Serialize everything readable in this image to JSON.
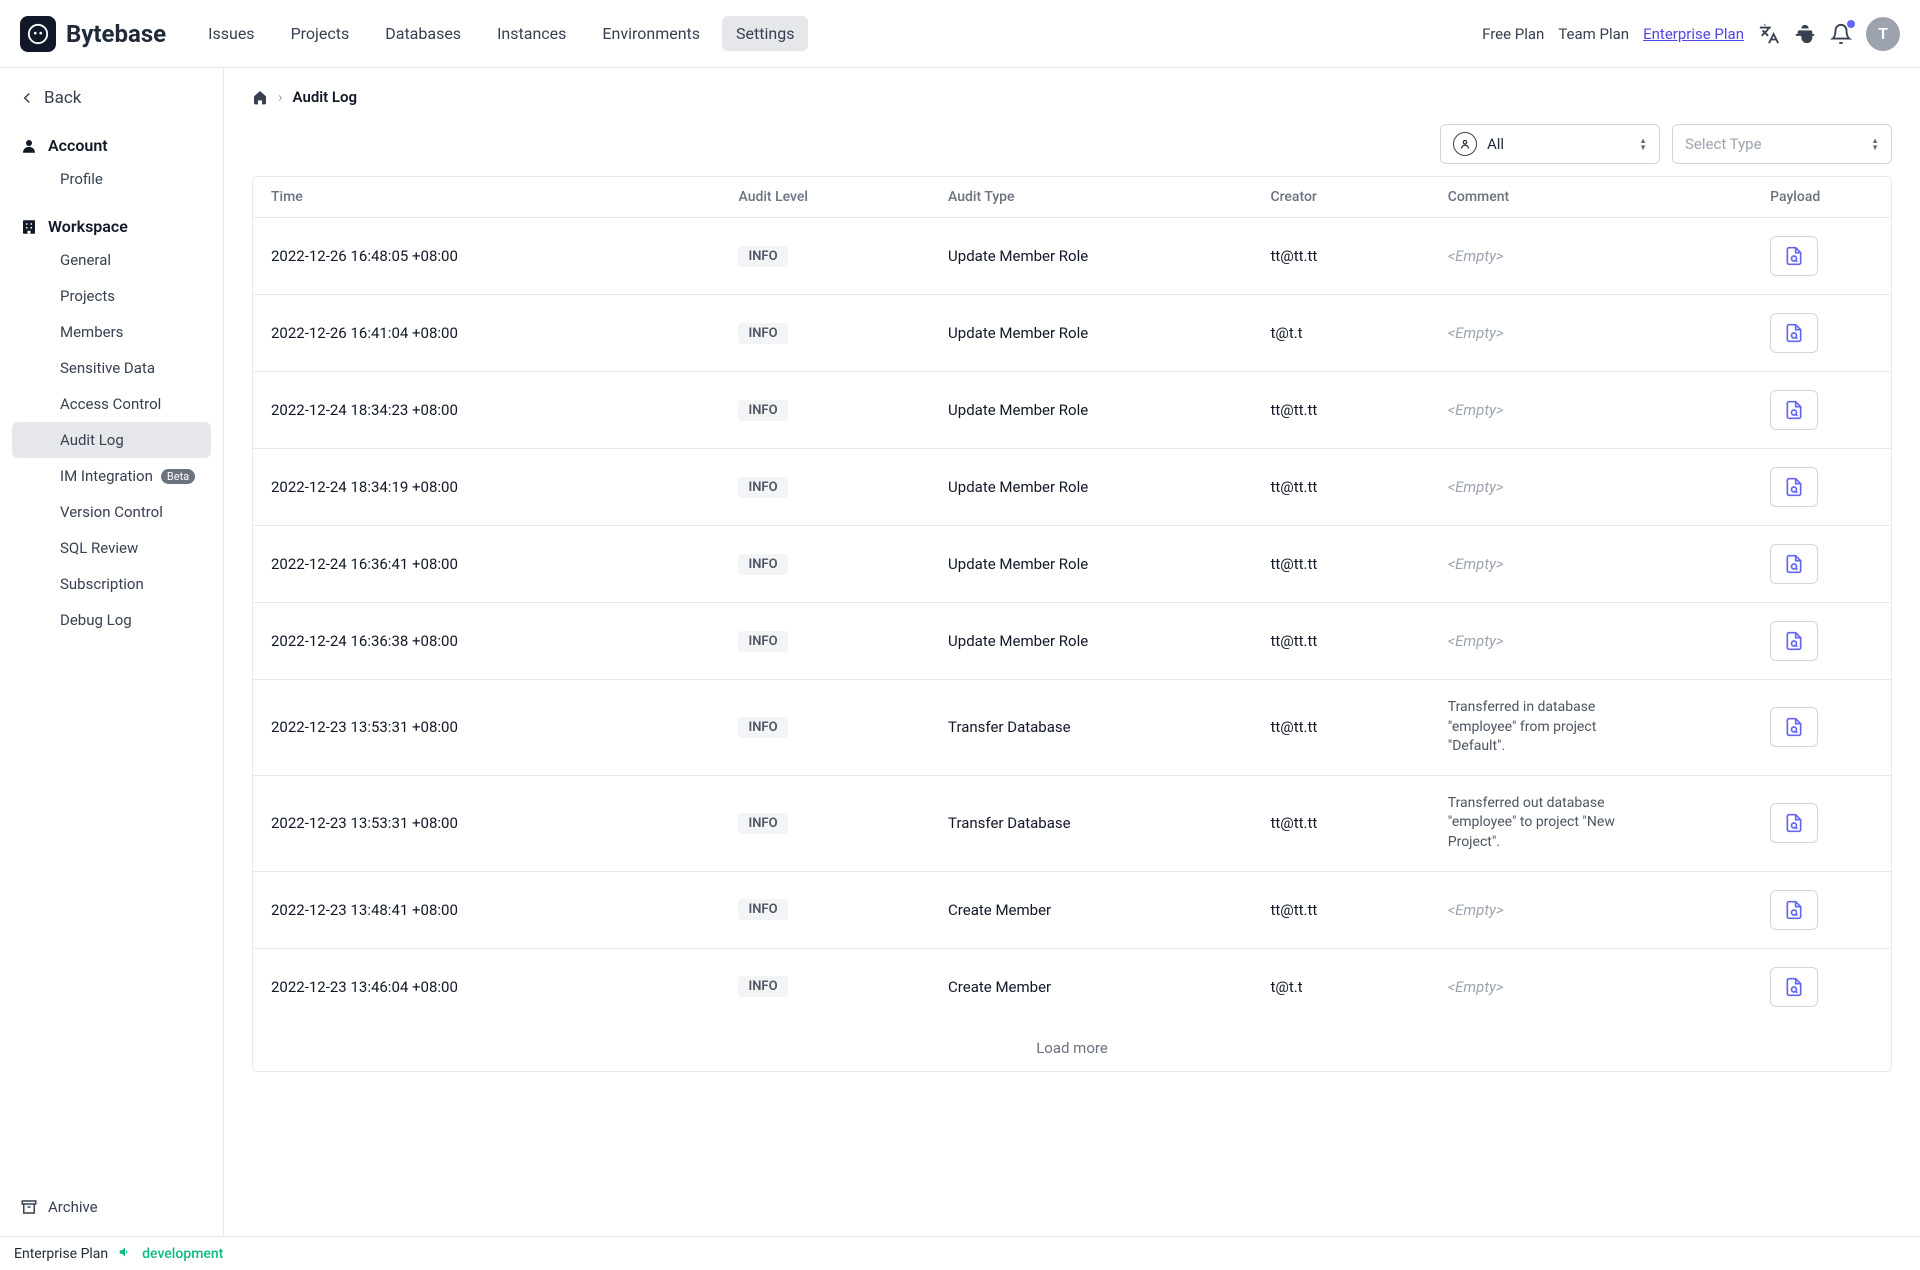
{
  "header": {
    "brand": "Bytebase",
    "nav": [
      "Issues",
      "Projects",
      "Databases",
      "Instances",
      "Environments",
      "Settings"
    ],
    "active_nav_index": 5,
    "free_plan": "Free Plan",
    "team_plan": "Team Plan",
    "enterprise_plan": "Enterprise Plan",
    "avatar_initial": "T"
  },
  "sidebar": {
    "back": "Back",
    "account_section": "Account",
    "account_items": [
      "Profile"
    ],
    "workspace_section": "Workspace",
    "workspace_items": [
      {
        "label": "General"
      },
      {
        "label": "Projects"
      },
      {
        "label": "Members"
      },
      {
        "label": "Sensitive Data"
      },
      {
        "label": "Access Control"
      },
      {
        "label": "Audit Log",
        "active": true
      },
      {
        "label": "IM Integration",
        "badge": "Beta"
      },
      {
        "label": "Version Control"
      },
      {
        "label": "SQL Review"
      },
      {
        "label": "Subscription"
      },
      {
        "label": "Debug Log"
      }
    ],
    "archive": "Archive"
  },
  "breadcrumb": {
    "current": "Audit Log"
  },
  "filters": {
    "creator_label": "All",
    "type_placeholder": "Select Type"
  },
  "table": {
    "headers": [
      "Time",
      "Audit Level",
      "Audit Type",
      "Creator",
      "Comment",
      "Payload"
    ],
    "empty_text": "<Empty>",
    "rows": [
      {
        "time": "2022-12-26 16:48:05 +08:00",
        "level": "INFO",
        "type": "Update Member Role",
        "creator": "tt@tt.tt",
        "comment": null
      },
      {
        "time": "2022-12-26 16:41:04 +08:00",
        "level": "INFO",
        "type": "Update Member Role",
        "creator": "t@t.t",
        "comment": null
      },
      {
        "time": "2022-12-24 18:34:23 +08:00",
        "level": "INFO",
        "type": "Update Member Role",
        "creator": "tt@tt.tt",
        "comment": null
      },
      {
        "time": "2022-12-24 18:34:19 +08:00",
        "level": "INFO",
        "type": "Update Member Role",
        "creator": "tt@tt.tt",
        "comment": null
      },
      {
        "time": "2022-12-24 16:36:41 +08:00",
        "level": "INFO",
        "type": "Update Member Role",
        "creator": "tt@tt.tt",
        "comment": null
      },
      {
        "time": "2022-12-24 16:36:38 +08:00",
        "level": "INFO",
        "type": "Update Member Role",
        "creator": "tt@tt.tt",
        "comment": null
      },
      {
        "time": "2022-12-23 13:53:31 +08:00",
        "level": "INFO",
        "type": "Transfer Database",
        "creator": "tt@tt.tt",
        "comment": "Transferred in database \"employee\" from project \"Default\"."
      },
      {
        "time": "2022-12-23 13:53:31 +08:00",
        "level": "INFO",
        "type": "Transfer Database",
        "creator": "tt@tt.tt",
        "comment": "Transferred out database \"employee\" to project \"New Project\"."
      },
      {
        "time": "2022-12-23 13:48:41 +08:00",
        "level": "INFO",
        "type": "Create Member",
        "creator": "tt@tt.tt",
        "comment": null
      },
      {
        "time": "2022-12-23 13:46:04 +08:00",
        "level": "INFO",
        "type": "Create Member",
        "creator": "t@t.t",
        "comment": null
      }
    ],
    "load_more": "Load more"
  },
  "footer": {
    "plan": "Enterprise Plan",
    "env": "development"
  }
}
